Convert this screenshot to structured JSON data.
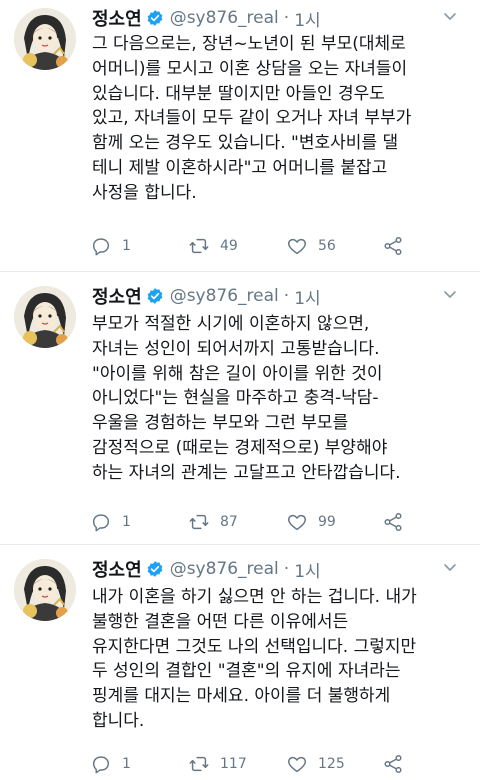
{
  "tweets": [
    {
      "name": "정소연",
      "handle": "@sy876_real",
      "dot": "·",
      "time": "1시",
      "lines": [
        "그 다음으로는, 장년~노년이 된 부모(대체로",
        "어머니)를 모시고 이혼 상담을 오는 자녀들이",
        "있습니다. 대부분 딸이지만 아들인 경우도",
        "있고, 자녀들이 모두 같이 오거나 자녀 부부가",
        "함께 오는 경우도 있습니다. \"변호사비를 댈",
        "테니 제발 이혼하시라\"고 어머니를 붙잡고",
        "사정을 합니다."
      ],
      "replies": "1",
      "retweets": "49",
      "likes": "56"
    },
    {
      "name": "정소연",
      "handle": "@sy876_real",
      "dot": "·",
      "time": "1시",
      "lines": [
        "부모가 적절한 시기에 이혼하지 않으면,",
        "자녀는 성인이 되어서까지 고통받습니다.",
        "\"아이를 위해 참은 길이 아이를 위한 것이",
        "아니었다\"는 현실을 마주하고 충격-낙담-",
        "우울을 경험하는 부모와 그런 부모를",
        "감정적으로 (때로는 경제적으로) 부양해야",
        "하는 자녀의 관계는 고달프고 안타깝습니다."
      ],
      "replies": "1",
      "retweets": "87",
      "likes": "99"
    },
    {
      "name": "정소연",
      "handle": "@sy876_real",
      "dot": "·",
      "time": "1시",
      "lines": [
        "내가 이혼을 하기 싫으면 안 하는 겁니다. 내가",
        "불행한 결혼을 어떤 다른 이유에서든",
        "유지한다면 그것도 나의 선택입니다. 그렇지만",
        "두 성인의 결합인 \"결혼\"의 유지에 자녀라는",
        "핑계를 대지는 마세요. 아이를 더 불행하게",
        "합니다."
      ],
      "replies": "1",
      "retweets": "117",
      "likes": "125"
    }
  ],
  "icons": {
    "verified": "verified-badge-icon",
    "menu": "chevron-down-icon",
    "reply": "reply-icon",
    "retweet": "retweet-icon",
    "like": "heart-icon",
    "share": "share-icon"
  },
  "colors": {
    "text": "#14171a",
    "secondary": "#657786",
    "verified": "#1da1f2",
    "divider": "#e6ecf0"
  }
}
